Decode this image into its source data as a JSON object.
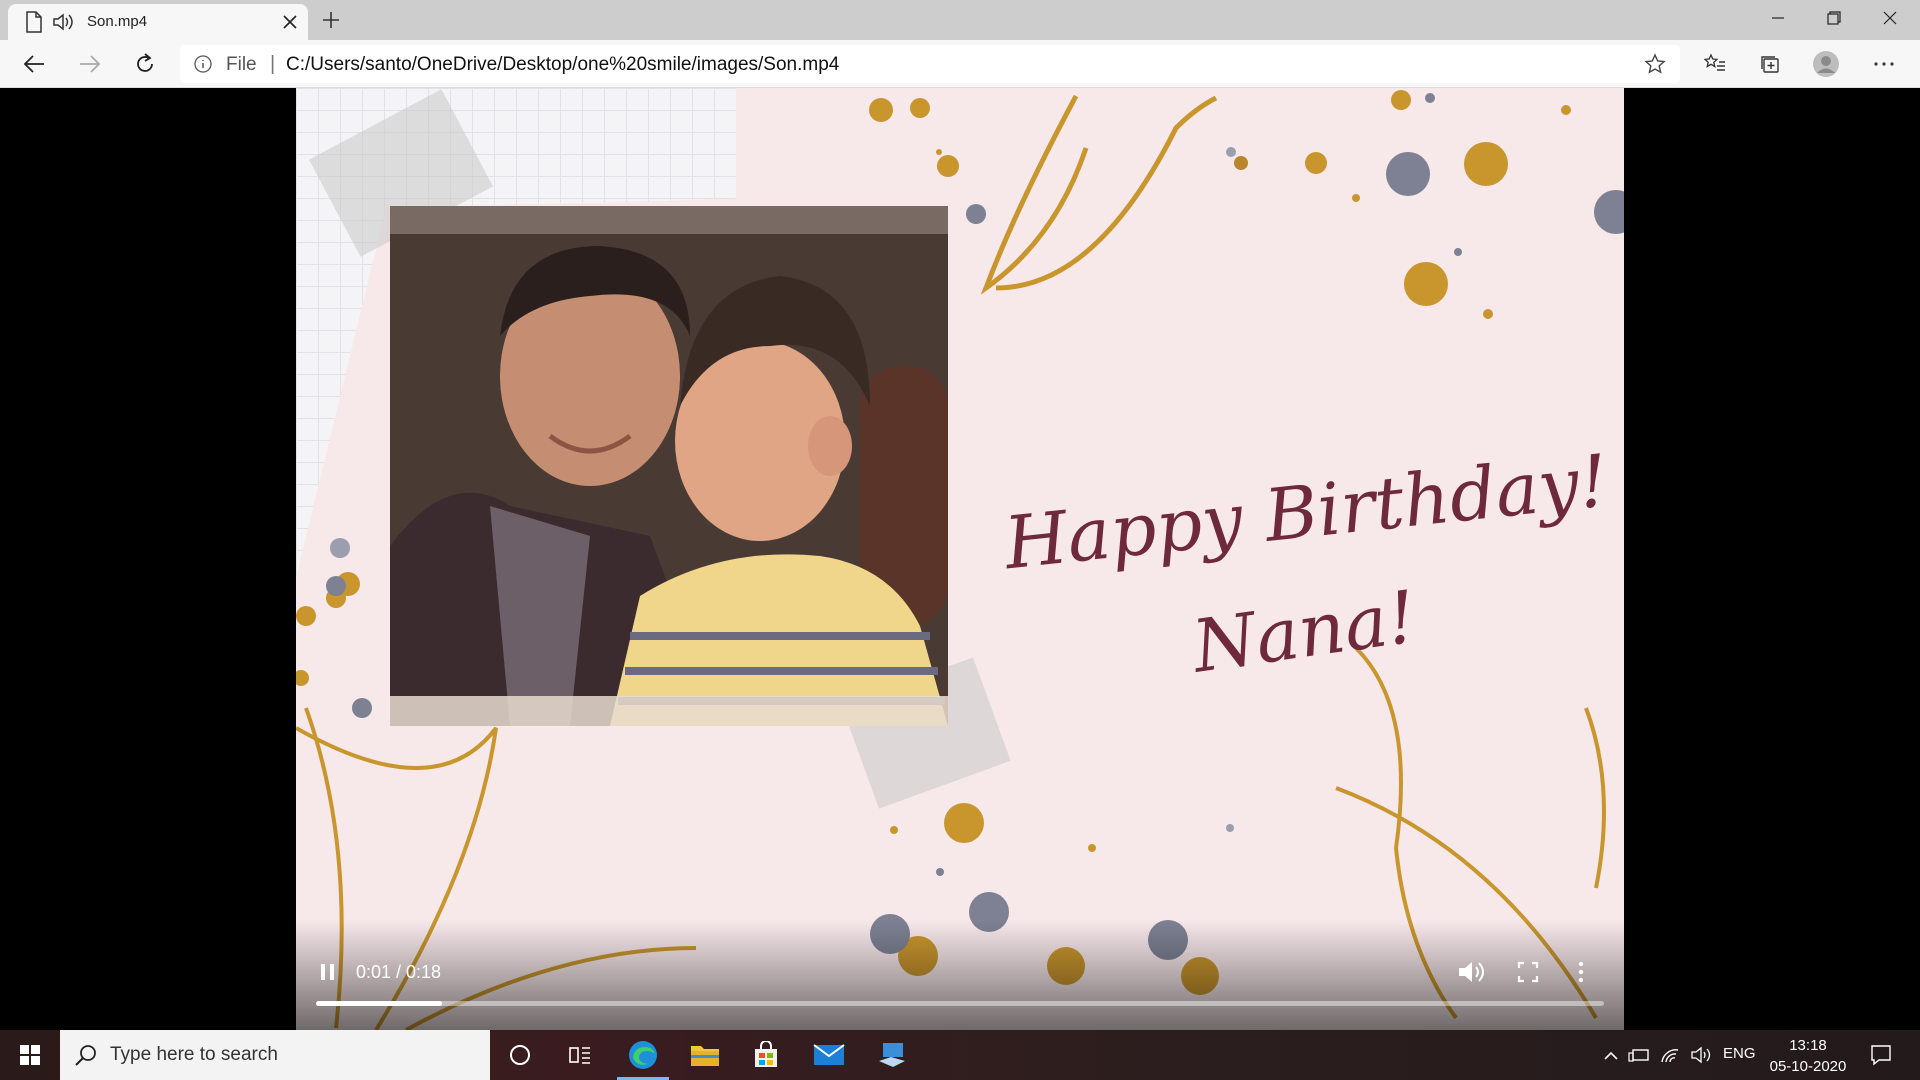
{
  "tab": {
    "title": "Son.mp4"
  },
  "address_bar": {
    "scheme_label": "File",
    "separator": "|",
    "url": "C:/Users/santo/OneDrive/Desktop/one%20smile/images/Son.mp4"
  },
  "video": {
    "greeting_line1": "Happy Birthday!",
    "greeting_line2": "Nana!",
    "time": "0:01 / 0:18",
    "progress_fraction": 0.098,
    "colors": {
      "background": "#f7e8ea",
      "gold": "#c9962e",
      "script": "#6e2a3c",
      "grey_dot": "#7d8193"
    }
  },
  "taskbar": {
    "search_placeholder": "Type here to search",
    "language": "ENG",
    "time": "13:18",
    "date": "05-10-2020",
    "apps": [
      "cortana-icon",
      "task-view-icon",
      "edge-icon",
      "file-explorer-icon",
      "store-icon",
      "mail-icon",
      "network-app-icon"
    ]
  }
}
